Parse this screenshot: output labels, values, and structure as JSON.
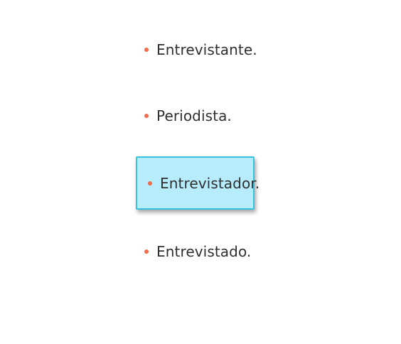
{
  "options": [
    {
      "label": "Entrevistante.",
      "selected": false
    },
    {
      "label": "Periodista.",
      "selected": false
    },
    {
      "label": "Entrevistador.",
      "selected": true
    },
    {
      "label": "Entrevistado.",
      "selected": false
    }
  ],
  "colors": {
    "bullet": "#f26a4f",
    "selected_fill": "#b7ecfc",
    "selected_border": "#36c3df",
    "text": "#2f2f2f"
  },
  "icons": {
    "bullet": "bullet-icon"
  }
}
